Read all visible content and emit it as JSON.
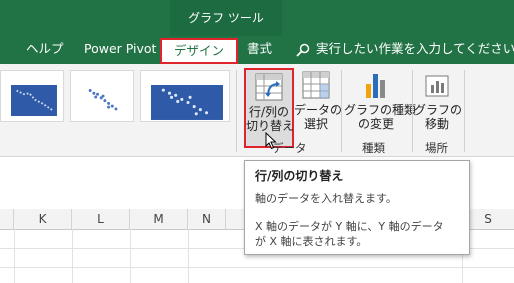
{
  "context_tab": {
    "label": "グラフ ツール"
  },
  "tabs": [
    {
      "label": "ヘルプ"
    },
    {
      "label": "Power Pivot"
    },
    {
      "label": "デザイン"
    },
    {
      "label": "書式"
    }
  ],
  "search": {
    "label": "実行したい作業を入力してください"
  },
  "ribbon": {
    "buttons": {
      "switch": {
        "line1": "行/列の",
        "line2": "切り替え"
      },
      "select_data": {
        "line1": "データの",
        "line2": "選択"
      },
      "change_type": {
        "line1": "グラフの種類",
        "line2": "の変更"
      },
      "move": {
        "line1": "グラフの",
        "line2": "移動"
      }
    },
    "groups": {
      "data": "データ",
      "type": "種類",
      "location": "場所"
    }
  },
  "columns": [
    "K",
    "L",
    "M",
    "N",
    "S"
  ],
  "tooltip": {
    "title": "行/列の切り替え",
    "line1": "軸のデータを入れ替えます。",
    "line2": "X 軸のデータが Y 軸に、Y 軸のデータ",
    "line3": "が X 軸に表されます。"
  },
  "colors": {
    "ribbon_green": "#217346",
    "highlight_red": "#e0242b",
    "chart_blue": "#2e5aa8"
  }
}
